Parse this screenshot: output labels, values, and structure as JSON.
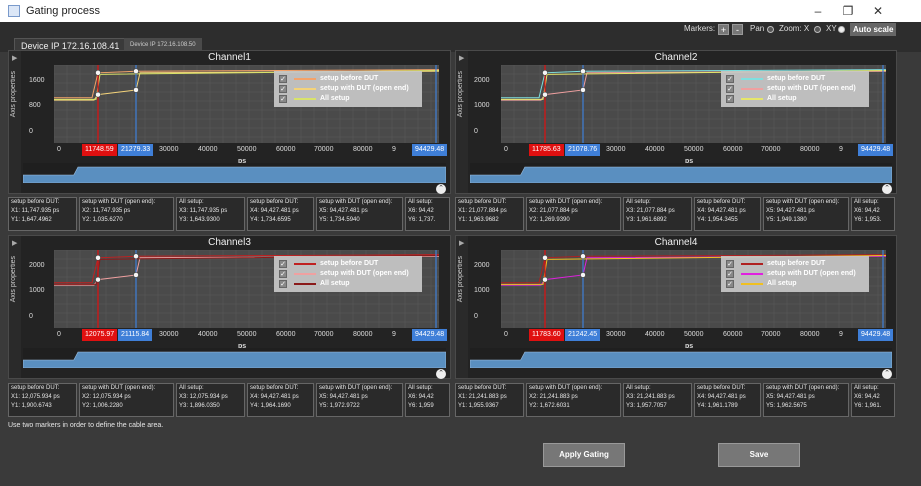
{
  "window": {
    "title": "Gating process"
  },
  "window_controls": {
    "minimize": "–",
    "maximize": "❐",
    "close": "✕"
  },
  "toolbar": {
    "markers_label": "Markers:",
    "marker_add": "+",
    "marker_remove": "-",
    "pan_label": "Pan",
    "zoom_label": "Zoom: X",
    "xy_label": "XY",
    "autoscale_label": "Auto scale"
  },
  "tabs": [
    {
      "label": "Device IP 172.16.108.41"
    },
    {
      "label": "Device IP 172.16.108.50"
    }
  ],
  "colors": {
    "red_marker": "#e01010",
    "blue_marker": "#3f7fd8",
    "overview_fill": "#5a8fc0"
  },
  "channels": [
    {
      "title": "Channel1",
      "axis_label": "Axis properties",
      "y_ticks": [
        "1600",
        "800",
        "0"
      ],
      "x_ticks": [
        "0",
        "30000",
        "40000",
        "50000",
        "60000",
        "70000",
        "80000",
        "9"
      ],
      "x_unit": "ps",
      "marker_red": "11748.59",
      "marker_blue": "21279.33",
      "marker_right": "94429.48",
      "legend": [
        "setup before DUT",
        "setup with DUT (open end)",
        "All setup"
      ],
      "legend_colors": [
        "#f4a36a",
        "#f4d37a",
        "#d9e36a"
      ],
      "readouts": [
        [
          "setup before DUT:",
          "X1: 11,747.935 ps",
          "Y1: 1,647.4962"
        ],
        [
          "setup with DUT (open end):",
          "X2: 11,747.935 ps",
          "Y2: 1,035.6270"
        ],
        [
          "All setup:",
          "X3: 11,747.935 ps",
          "Y3: 1,643.9300"
        ],
        [
          "setup before DUT:",
          "X4: 94,427.481 ps",
          "Y4: 1,734.6595"
        ],
        [
          "setup with DUT (open end):",
          "X5: 94,427.481 ps",
          "Y5: 1,734.5940"
        ],
        [
          "All setup:",
          "X6: 94,42",
          "Y6: 1,737."
        ]
      ]
    },
    {
      "title": "Channel2",
      "axis_label": "Axis properties",
      "y_ticks": [
        "2000",
        "1000",
        "0"
      ],
      "x_ticks": [
        "0",
        "30000",
        "40000",
        "50000",
        "60000",
        "70000",
        "80000",
        "9"
      ],
      "x_unit": "ps",
      "marker_red": "11785.63",
      "marker_blue": "21078.76",
      "marker_right": "94429.48",
      "legend": [
        "setup before DUT",
        "setup with DUT (open end)",
        "All setup"
      ],
      "legend_colors": [
        "#7fe0e0",
        "#f0a0a0",
        "#e6e66a"
      ],
      "readouts": [
        [
          "setup before DUT:",
          "X1: 21,077.884 ps",
          "Y1: 1,963.9682"
        ],
        [
          "setup with DUT (open end):",
          "X2: 21,077.884 ps",
          "Y2: 1,269.9390"
        ],
        [
          "All setup:",
          "X3: 21,077.884 ps",
          "Y3: 1,961.6892"
        ],
        [
          "setup before DUT:",
          "X4: 94,427.481 ps",
          "Y4: 1,954.3455"
        ],
        [
          "setup with DUT (open end):",
          "X5: 94,427.481 ps",
          "Y5: 1,949.1380"
        ],
        [
          "All setup:",
          "X6: 94,42",
          "Y6: 1,953."
        ]
      ]
    },
    {
      "title": "Channel3",
      "axis_label": "Axis properties",
      "y_ticks": [
        "2000",
        "1000",
        "0"
      ],
      "x_ticks": [
        "0",
        "30000",
        "40000",
        "50000",
        "60000",
        "70000",
        "80000",
        "9"
      ],
      "x_unit": "ps",
      "marker_red": "12075.97",
      "marker_blue": "21115.84",
      "marker_right": "94429.48",
      "legend": [
        "setup before DUT",
        "setup with DUT (open end)",
        "All setup"
      ],
      "legend_colors": [
        "#c02020",
        "#f0a0a0",
        "#8a1a1a"
      ],
      "readouts": [
        [
          "setup before DUT:",
          "X1: 12,075.934 ps",
          "Y1: 1,900.6743"
        ],
        [
          "setup with DUT (open end):",
          "X2: 12,075.934 ps",
          "Y2: 1,006.2280"
        ],
        [
          "All setup:",
          "X3: 12,075.934 ps",
          "Y3: 1,896.0350"
        ],
        [
          "setup before DUT:",
          "X4: 94,427.481 ps",
          "Y4: 1,964.1690"
        ],
        [
          "setup with DUT (open end):",
          "X5: 94,427.481 ps",
          "Y5: 1,972.9722"
        ],
        [
          "All setup:",
          "X6: 94,42",
          "Y6: 1,959"
        ]
      ]
    },
    {
      "title": "Channel4",
      "axis_label": "Axis properties",
      "y_ticks": [
        "2000",
        "1000",
        "0"
      ],
      "x_ticks": [
        "0",
        "30000",
        "40000",
        "50000",
        "60000",
        "70000",
        "80000",
        "9"
      ],
      "x_unit": "ps",
      "marker_red": "11783.60",
      "marker_blue": "21242.45",
      "marker_right": "94429.48",
      "legend": [
        "setup before DUT",
        "setup with DUT (open end)",
        "All setup"
      ],
      "legend_colors": [
        "#b02020",
        "#e020e0",
        "#f0c020"
      ],
      "readouts": [
        [
          "setup before DUT:",
          "X1: 21,241.883 ps",
          "Y1: 1,955.9367"
        ],
        [
          "setup with DUT (open end):",
          "X2: 21,241.883 ps",
          "Y2: 1,672.6031"
        ],
        [
          "All setup:",
          "X3: 21,241.883 ps",
          "Y3: 1,957.7057"
        ],
        [
          "setup before DUT:",
          "X4: 94,427.481 ps",
          "Y4: 1,961.1789"
        ],
        [
          "setup with DUT (open end):",
          "X5: 94,427.481 ps",
          "Y5: 1,962.5675"
        ],
        [
          "All setup:",
          "X6: 94,42",
          "Y6: 1,961."
        ]
      ]
    }
  ],
  "status_text": "Use two markers in order to define the cable area.",
  "buttons": {
    "apply": "Apply Gating",
    "save": "Save"
  }
}
